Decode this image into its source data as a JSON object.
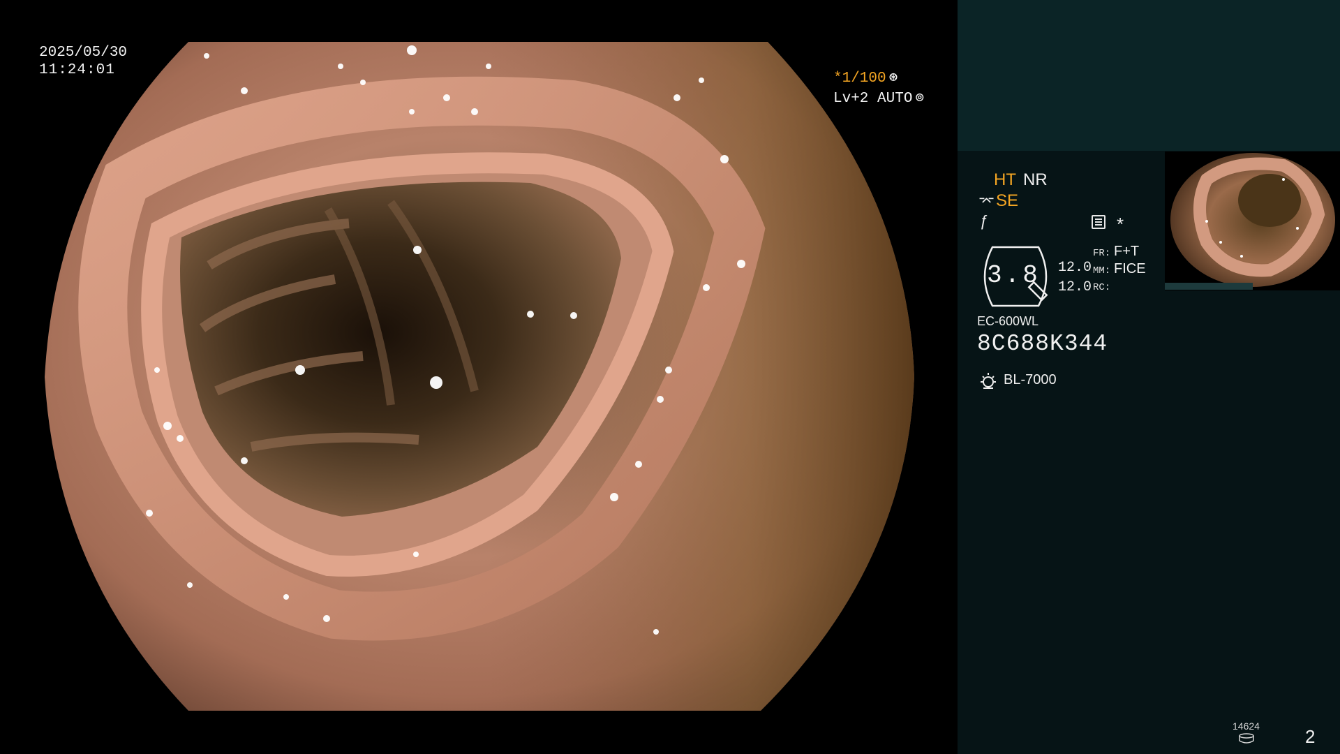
{
  "overlay": {
    "date": "2025/05/30",
    "time": "11:24:01",
    "shutter": "*1/100",
    "iris": "Lv+2 AUTO"
  },
  "panel": {
    "ht": "HT",
    "nr": "NR",
    "se": "SE",
    "gauge_value": "3.8",
    "value_1": "12.0",
    "value_2": "12.0",
    "fr_label": "FR:",
    "fr_value": "F+T",
    "mm_label": "MM:",
    "mm_value": "FICE",
    "rc_label": "RC:",
    "scope_model": "EC-600WL",
    "serial": "8C688K344",
    "light_source": "BL-7000",
    "image_counter": "14624",
    "page_number": "2"
  },
  "colors": {
    "accent_orange": "#f5a623",
    "panel_bg": "#061416",
    "panel_top_bg": "#0b2426"
  },
  "icons": [
    "shutter-mode-icon",
    "iris-icon",
    "scope-icon",
    "f-icon",
    "menu-icon",
    "gauge-icon",
    "lamp-icon",
    "disk-icon"
  ]
}
